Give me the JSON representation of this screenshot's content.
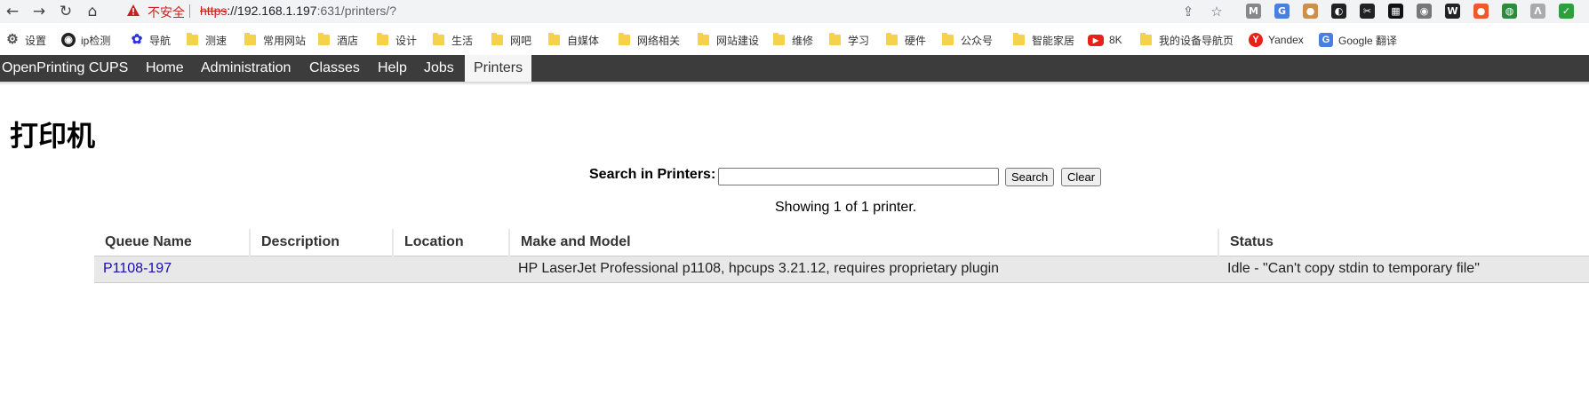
{
  "browser": {
    "insecure_label": "不安全",
    "url_scheme": "https",
    "url_host": "://192.168.1.197",
    "url_rest": ":631/printers/?",
    "extensions": [
      {
        "name": "gmail-icon",
        "glyph": "M",
        "color": "#888"
      },
      {
        "name": "translate-icon",
        "glyph": "G",
        "color": "#4a7fe0"
      },
      {
        "name": "cookie-icon",
        "glyph": "●",
        "color": "#c9914b"
      },
      {
        "name": "extension-dark-icon",
        "glyph": "◐",
        "color": "#222"
      },
      {
        "name": "scissors-icon",
        "glyph": "✂",
        "color": "#222"
      },
      {
        "name": "tab-manager-icon",
        "glyph": "▦",
        "color": "#111"
      },
      {
        "name": "camera-icon",
        "glyph": "◉",
        "color": "#777"
      },
      {
        "name": "w-extension-icon",
        "glyph": "W",
        "color": "#222"
      },
      {
        "name": "orange-extension-icon",
        "glyph": "●",
        "color": "#f0572a"
      },
      {
        "name": "globe-extension-icon",
        "glyph": "◍",
        "color": "#2f8a3b"
      },
      {
        "name": "lambda-extension-icon",
        "glyph": "Λ",
        "color": "#aaa"
      },
      {
        "name": "shield-check-icon",
        "glyph": "✓",
        "color": "#2e9e3f"
      }
    ]
  },
  "bookmarks": [
    {
      "label": "设置",
      "icon": "gear-icon"
    },
    {
      "label": "ip检测",
      "icon": "ip-icon"
    },
    {
      "label": "导航",
      "icon": "baidu-icon"
    },
    {
      "label": "测速",
      "icon": "folder-icon"
    },
    {
      "label": "常用网站",
      "icon": "folder-icon"
    },
    {
      "label": "酒店",
      "icon": "folder-icon"
    },
    {
      "label": "设计",
      "icon": "folder-icon"
    },
    {
      "label": "生活",
      "icon": "folder-icon"
    },
    {
      "label": "网吧",
      "icon": "folder-icon"
    },
    {
      "label": "自媒体",
      "icon": "folder-icon"
    },
    {
      "label": "网络相关",
      "icon": "folder-icon"
    },
    {
      "label": "网站建设",
      "icon": "folder-icon"
    },
    {
      "label": "维修",
      "icon": "folder-icon"
    },
    {
      "label": "学习",
      "icon": "folder-icon"
    },
    {
      "label": "硬件",
      "icon": "folder-icon"
    },
    {
      "label": "公众号",
      "icon": "folder-icon"
    },
    {
      "label": "智能家居",
      "icon": "folder-icon"
    },
    {
      "label": "8K",
      "icon": "youtube-icon"
    },
    {
      "label": "我的设备导航页",
      "icon": "folder-icon"
    },
    {
      "label": "Yandex",
      "icon": "yandex-icon"
    },
    {
      "label": "Google 翻译",
      "icon": "translate-icon"
    }
  ],
  "cups_nav": {
    "brand": "OpenPrinting CUPS",
    "items": [
      "Home",
      "Administration",
      "Classes",
      "Help",
      "Jobs",
      "Printers"
    ],
    "active": "Printers"
  },
  "page": {
    "title": "打印机",
    "search_label": "Search in Printers:",
    "search_value": "",
    "search_button": "Search",
    "clear_button": "Clear",
    "showing": "Showing 1 of 1 printer."
  },
  "table": {
    "headers": [
      "Queue Name",
      "Description",
      "Location",
      "Make and Model",
      "Status"
    ],
    "rows": [
      [
        "P1108-197",
        "",
        "",
        "HP LaserJet Professional p1108, hpcups 3.21.12, requires proprietary plugin",
        "Idle - \"Can't copy stdin to temporary file\""
      ]
    ]
  }
}
